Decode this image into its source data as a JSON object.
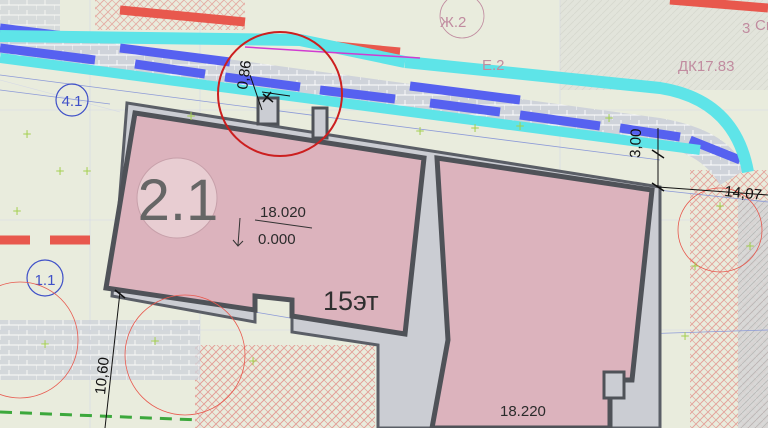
{
  "plan": {
    "building_id": "2.1",
    "elevation_top": "18.020",
    "elevation_bottom": "0.000",
    "floors_label": "15эт",
    "elevation_lower": "18.220",
    "zones": {
      "zone_4_1": "4.1",
      "zone_1_1": "1.1"
    },
    "road_labels": {
      "zh2": "Ж.2",
      "e2": "Е.2",
      "dk": "ДК17.83",
      "partial": "Св",
      "ghost_3": "3"
    },
    "dimensions": {
      "d_086": "0,86",
      "d_300": "3,00",
      "d_1407": "14,07",
      "d_1060": "10,60"
    }
  },
  "colors": {
    "building_fill": "#dcb3bd",
    "wall": "#5a5e66",
    "road_cyan": "#5ee4e8",
    "road_blue": "#5661f0",
    "red_marking": "#e8584d",
    "highlight_circle": "#cc1f1f",
    "background": "#e9ecdd"
  }
}
